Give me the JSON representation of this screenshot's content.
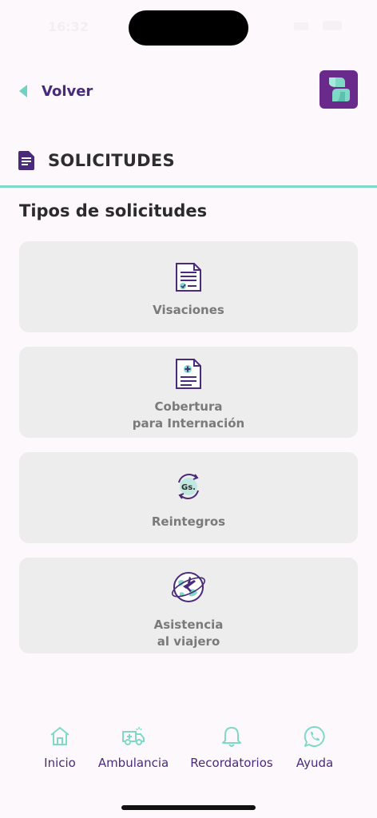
{
  "status_bar": {
    "time": "16:32"
  },
  "header": {
    "back_label": "Volver"
  },
  "section": {
    "title": "SOLICITUDES"
  },
  "page": {
    "subtitle": "Tipos de solicitudes"
  },
  "cards": [
    {
      "line1": "Visaciones",
      "line2": "",
      "icon": "document-check-icon"
    },
    {
      "line1": "Cobertura",
      "line2": "para Internación",
      "icon": "medical-document-icon"
    },
    {
      "line1": "Reintegros",
      "line2": "",
      "icon": "refund-currency-icon"
    },
    {
      "line1": "Asistencia",
      "line2": "al viajero",
      "icon": "globe-airplane-icon"
    }
  ],
  "bottom_nav": [
    {
      "label": "Inicio",
      "icon": "home-icon"
    },
    {
      "label": "Ambulancia",
      "icon": "ambulance-icon"
    },
    {
      "label": "Recordatorios",
      "icon": "bell-icon"
    },
    {
      "label": "Ayuda",
      "icon": "whatsapp-icon"
    }
  ],
  "colors": {
    "accent": "#7fd9c7",
    "brand_purple": "#4a2a7a",
    "card_bg": "#ededed",
    "background": "#fdf8fc"
  }
}
